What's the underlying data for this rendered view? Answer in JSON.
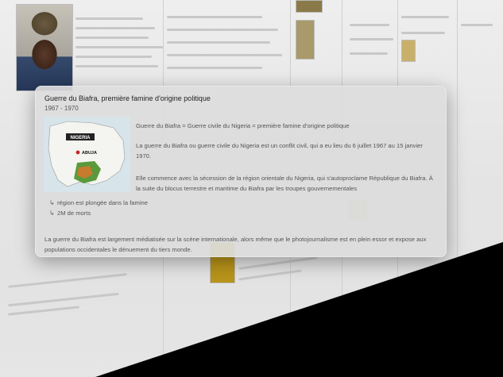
{
  "card": {
    "title": "Guerre du Biafra, première famine d'origine politique",
    "dates": "1967 - 1970",
    "paragraphs": [
      "Guerre du Biafra = Guerre civile du Nigeria = première famine d'origine politique",
      "La guerre du Biafra ou guerre civile du Nigeria est un conflit civil, qui a eu lieu du 6 juillet 1967 au 15 janvier 1970.",
      "Elle commence avec la sécession de la région orientale du Nigeria, qui s'autoproclame République du Biafra. À la suite du blocus terrestre et maritime du Biafra par les troupes gouvernementales"
    ],
    "sub_items": [
      "région est plongée dans la famine",
      "2M de morts"
    ],
    "footer": "La guerre du Biafra est largement médiatisée sur la scène internationale, alors même que le photojournalisme est en plein essor et expose aux populations occidentales le dénuement du tiers monde.",
    "map_labels": {
      "country": "NIGERIA",
      "city": "ABUJA"
    }
  },
  "colors": {
    "map_water": "#d7e4ea",
    "map_land": "#f4f4f0",
    "biafra_green": "#5a9a3c",
    "biafra_orange": "#d9752a",
    "city_dot": "#c0272d"
  },
  "icons": {
    "sub_item": "return-arrow-icon",
    "capital_marker": "red-dot-icon"
  }
}
